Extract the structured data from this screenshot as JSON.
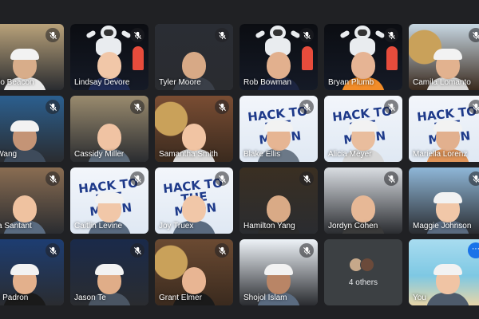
{
  "participants": [
    {
      "name": "gelo Beacon",
      "muted": true,
      "bg": "#b9a27a",
      "skin": "#d8ad8a",
      "shirt": "#e8e8e8",
      "cap": "#f2f2f2",
      "scene": "plain"
    },
    {
      "name": "Lindsay Devore",
      "muted": true,
      "bg": "#111318",
      "skin": "#f1c7a8",
      "shirt": "#1f2b55",
      "cap": "",
      "scene": "space"
    },
    {
      "name": "Tyler Moore",
      "muted": true,
      "bg": "#2a2d34",
      "skin": "#d7a986",
      "shirt": "#3a3f48",
      "cap": "",
      "scene": "plain"
    },
    {
      "name": "Rob Bowman",
      "muted": true,
      "bg": "#0d0f14",
      "skin": "#e2b08e",
      "shirt": "#1c2440",
      "cap": "",
      "scene": "space"
    },
    {
      "name": "Bryan Plumb",
      "muted": true,
      "bg": "#0d0f14",
      "skin": "#e6b494",
      "shirt": "#f28c28",
      "cap": "",
      "scene": "space"
    },
    {
      "name": "Camila Lomanto",
      "muted": true,
      "bg": "#c7d7e2",
      "skin": "#e2b28f",
      "shirt": "#d9d9d9",
      "cap": "#f2f2f2",
      "scene": "food"
    },
    {
      "name": "e Wang",
      "muted": true,
      "bg": "#2b5f8f",
      "skin": "#c49476",
      "shirt": "#3e4b5b",
      "cap": "#f2f2f2",
      "scene": "plain"
    },
    {
      "name": "Cassidy Miller",
      "muted": true,
      "bg": "#9a8b6e",
      "skin": "#f0c3a3",
      "shirt": "#5d6b7a",
      "cap": "",
      "scene": "plain"
    },
    {
      "name": "Samantha Smith",
      "muted": true,
      "bg": "#7a4d33",
      "skin": "#f1c4a3",
      "shirt": "#dcdcdc",
      "cap": "",
      "scene": "food"
    },
    {
      "name": "Blake Ellis",
      "muted": true,
      "bg": "#eef3f8",
      "skin": "#e6b593",
      "shirt": "#6b7887",
      "cap": "#f2f2f2",
      "scene": "sign"
    },
    {
      "name": "Alicia Meyer",
      "muted": true,
      "bg": "#eef3f8",
      "skin": "#e9bd9d",
      "shirt": "#d7d7d7",
      "cap": "#f2f2f2",
      "scene": "sign"
    },
    {
      "name": "Mariella Lorenz",
      "muted": true,
      "bg": "#eef3f8",
      "skin": "#e2b08e",
      "shirt": "#e0955a",
      "cap": "#f2f2f2",
      "scene": "sign"
    },
    {
      "name": "ssa Santant",
      "muted": true,
      "bg": "#8a6d52",
      "skin": "#efc2a0",
      "shirt": "#5a6b80",
      "cap": "",
      "scene": "plain"
    },
    {
      "name": "Caitlin Levine",
      "muted": true,
      "bg": "#eef3f8",
      "skin": "#f1c7a8",
      "shirt": "#5a6b80",
      "cap": "#f2f2f2",
      "scene": "sign"
    },
    {
      "name": "Joy Truex",
      "muted": true,
      "bg": "#eef3f8",
      "skin": "#f1c7a8",
      "shirt": "#5a6b80",
      "cap": "",
      "scene": "sign"
    },
    {
      "name": "Hamilton Yang",
      "muted": true,
      "bg": "#3a2f22",
      "skin": "#d9aa86",
      "shirt": "#2b2b2b",
      "cap": "",
      "scene": "plain"
    },
    {
      "name": "Jordyn Cohen",
      "muted": true,
      "bg": "#d9dde2",
      "skin": "#e7b896",
      "shirt": "#3a3a3a",
      "cap": "",
      "scene": "plain"
    },
    {
      "name": "Maggie Johnson",
      "muted": true,
      "bg": "#8fb7d8",
      "skin": "#f1c7a8",
      "shirt": "#5a6b80",
      "cap": "#f2f2f2",
      "scene": "plain"
    },
    {
      "name": "ole Padron",
      "muted": true,
      "bg": "#1d3d72",
      "skin": "#e3b08c",
      "shirt": "#1a1a1a",
      "cap": "#f2f2f2",
      "scene": "plain"
    },
    {
      "name": "Jason Te",
      "muted": true,
      "bg": "#1a2a4a",
      "skin": "#e0ad88",
      "shirt": "#4a5563",
      "cap": "#f2f2f2",
      "scene": "plain"
    },
    {
      "name": "Grant Elmer",
      "muted": true,
      "bg": "#6b4a32",
      "skin": "#e8b593",
      "shirt": "#1a1a1a",
      "cap": "",
      "scene": "food"
    },
    {
      "name": "Shojol Islam",
      "muted": true,
      "bg": "#eef3f8",
      "skin": "#b98566",
      "shirt": "#5a6b80",
      "cap": "#f2f2f2",
      "scene": "plain"
    }
  ],
  "others": {
    "label": "4 others",
    "avatars": [
      "#c6a88a",
      "#6b4a3a"
    ]
  },
  "self": {
    "name": "You",
    "bg": "#7ec8e3",
    "skin": "#f0c4a4",
    "shirt": "#4e5b6b",
    "cap": "#f2f2f2",
    "more_icon": "⋯"
  },
  "sign_text": "HACK TO THE MOON",
  "colors": {
    "page": "#202124",
    "tile": "#3c4043",
    "accent": "#8ab4f8"
  }
}
